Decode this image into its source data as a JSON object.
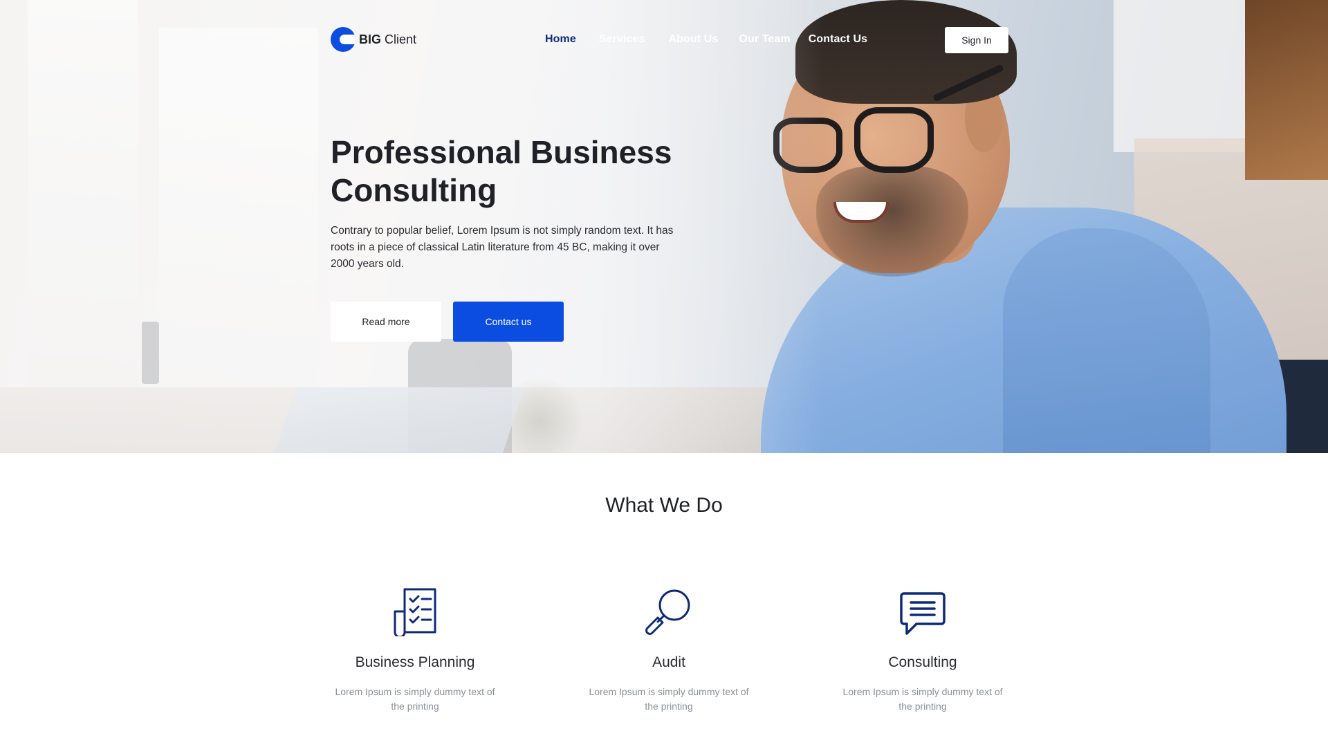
{
  "brand": {
    "bold": "BIG",
    "light": " Client",
    "accent_color": "#0b4de0",
    "dark_color": "#0d2a7a"
  },
  "nav": {
    "items": [
      {
        "label": "Home",
        "active": true
      },
      {
        "label": "Services",
        "active": false
      },
      {
        "label": "About Us",
        "active": false
      },
      {
        "label": "Our Team",
        "active": false
      },
      {
        "label": "Contact Us",
        "active": false
      }
    ],
    "signin_label": "Sign In"
  },
  "hero": {
    "title": "Professional Business Consulting",
    "copy": "Contrary to popular belief, Lorem Ipsum is not simply random text. It has roots in a piece of classical Latin literature from 45 BC, making it over 2000 years old.",
    "read_more_label": "Read more",
    "contact_label": "Contact us"
  },
  "what_we_do": {
    "title": "What We Do",
    "services": [
      {
        "name": "Business Planning",
        "desc": "Lorem Ipsum is simply dummy text of the printing",
        "icon": "checklist-icon"
      },
      {
        "name": "Audit",
        "desc": "Lorem Ipsum is simply dummy text of the printing",
        "icon": "magnifier-icon"
      },
      {
        "name": "Consulting",
        "desc": "Lorem Ipsum is simply dummy text of the printing",
        "icon": "chat-bubble-icon"
      }
    ]
  }
}
